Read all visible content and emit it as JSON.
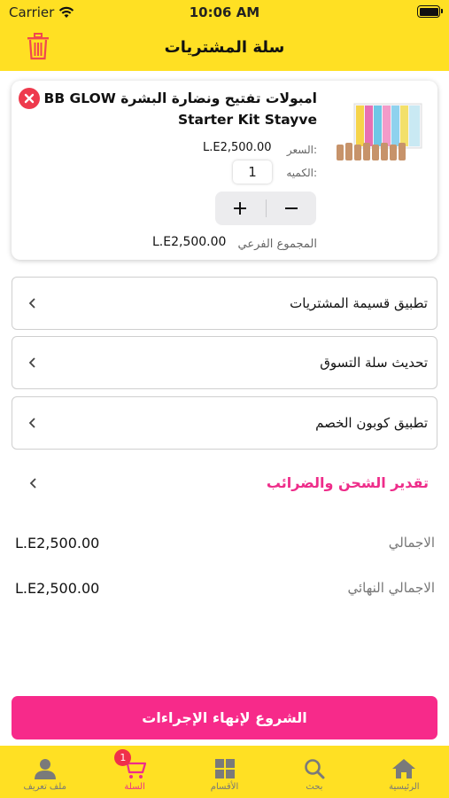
{
  "status_bar": {
    "carrier": "Carrier",
    "time": "10:06 AM"
  },
  "header": {
    "title": "سلة المشتريات"
  },
  "cart_item": {
    "title": "امبولات تفتيح ونضارة البشرة BB GLOW Starter Kit Stayve",
    "price_label": "السعر:",
    "price": "L.E2,500.00",
    "quantity_label": "الكميه:",
    "quantity": "1",
    "subtotal_label": "المجموع الفرعي",
    "subtotal": "L.E2,500.00"
  },
  "options": {
    "installments": "تطبيق قسيمة المشتريات",
    "update_cart": "تحديث سلة التسوق",
    "coupon": "تطبيق كوبون الخصم",
    "shipping": "تقدير الشحن والضرائب"
  },
  "totals": {
    "total_label": "الاجمالي",
    "total": "L.E2,500.00",
    "grand_total_label": "الاجمالي النهائي",
    "grand_total": "L.E2,500.00"
  },
  "checkout_label": "الشروع لإنهاء الإجراءات",
  "tabbar": {
    "profile": "ملف تعريف",
    "cart": "السلة",
    "cart_badge": "1",
    "categories": "الأقسام",
    "search": "بحث",
    "home": "الرئيسية"
  },
  "colors": {
    "brand_yellow": "#ffe023",
    "accent_pink": "#f72a8a",
    "remove_red": "#ee3a4d"
  }
}
